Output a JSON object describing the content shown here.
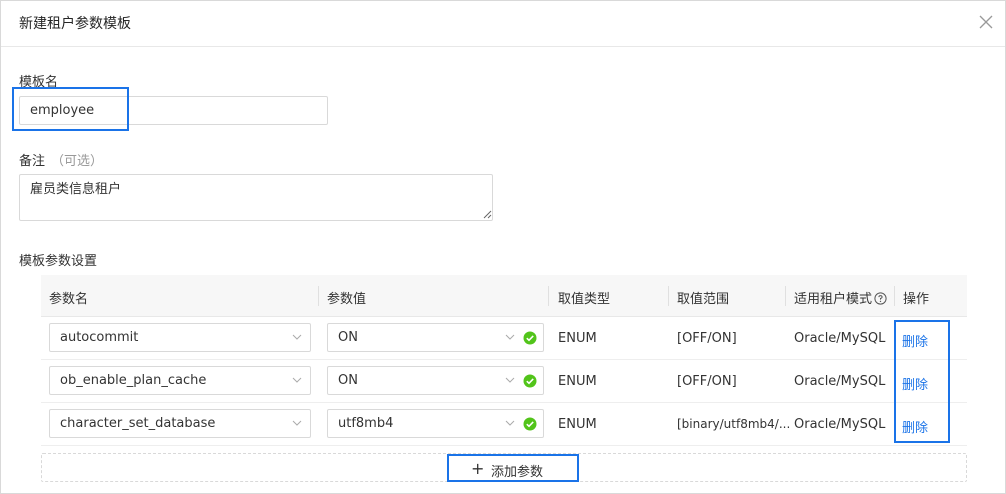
{
  "dialog": {
    "title": "新建租户参数模板"
  },
  "form": {
    "name_label": "模板名",
    "name_value": "employee",
    "remark_label": "备注",
    "remark_optional": "（可选）",
    "remark_value": "雇员类信息租户",
    "params_label": "模板参数设置"
  },
  "table": {
    "headers": {
      "param_name": "参数名",
      "param_value": "参数值",
      "value_type": "取值类型",
      "value_range": "取值范围",
      "tenant_mode": "适用租户模式",
      "action": "操作"
    },
    "rows": [
      {
        "name": "autocommit",
        "value": "ON",
        "type": "ENUM",
        "range": "[OFF/ON]",
        "mode": "Oracle/MySQL",
        "action": "删除"
      },
      {
        "name": "ob_enable_plan_cache",
        "value": "ON",
        "type": "ENUM",
        "range": "[OFF/ON]",
        "mode": "Oracle/MySQL",
        "action": "删除"
      },
      {
        "name": "character_set_database",
        "value": "utf8mb4",
        "type": "ENUM",
        "range": "[binary/utf8mb4/...",
        "mode": "Oracle/MySQL",
        "action": "删除"
      }
    ]
  },
  "add_button": {
    "label": "添加参数"
  },
  "colors": {
    "accent": "#1a73e8",
    "success": "#52c41a",
    "border": "#d9d9d9"
  }
}
